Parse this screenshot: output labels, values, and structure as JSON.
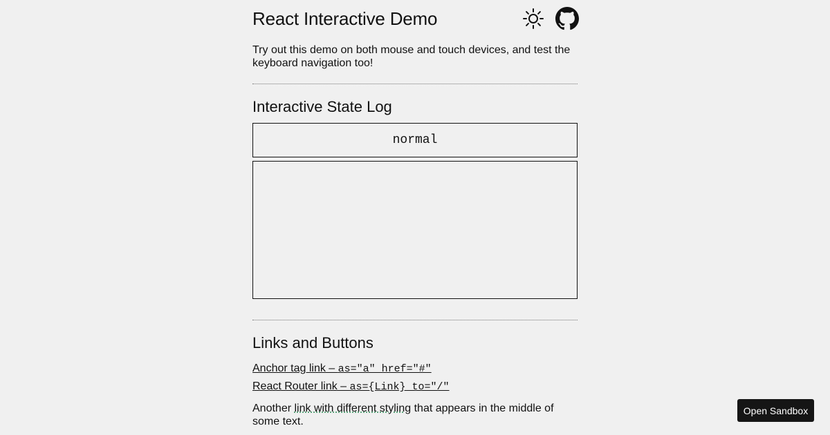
{
  "header": {
    "title": "React Interactive Demo",
    "theme_icon": "sun-icon",
    "github_icon": "github-icon"
  },
  "intro": {
    "text": "Try out this demo on both mouse and touch devices, and test the keyboard navigation too!"
  },
  "state_log": {
    "heading": "Interactive State Log",
    "current_state": "normal",
    "entries": []
  },
  "links_section": {
    "heading": "Links and Buttons",
    "anchor_link": {
      "label": "Anchor tag link – ",
      "code": "as=\"a\" href=\"#\""
    },
    "router_link": {
      "label": "React Router link – ",
      "code": "as={Link} to=\"/\""
    },
    "paragraph": {
      "before": "Another ",
      "link": "link with different styling",
      "after": " that appears in the middle of some text."
    }
  },
  "sandbox_button": {
    "label": "Open Sandbox"
  },
  "colors": {
    "background": "#f0f0f0",
    "text": "#111111",
    "button_bg": "#151515",
    "link_underline_accent": "#2e8b57"
  }
}
